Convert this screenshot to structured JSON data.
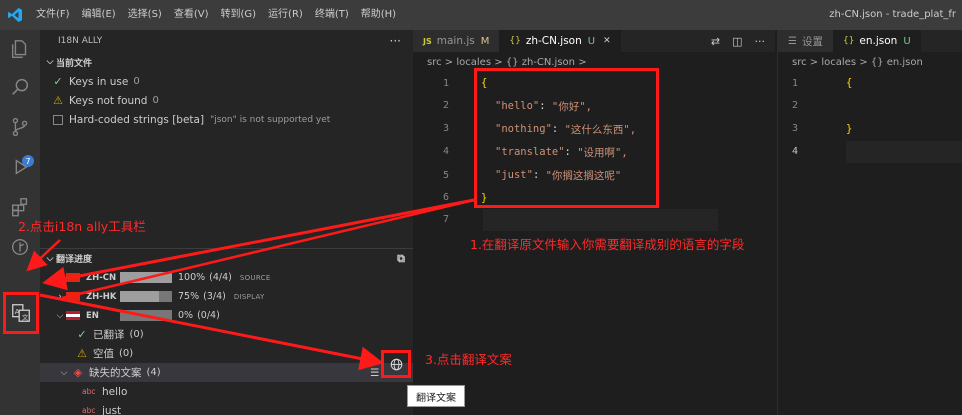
{
  "titlebar": {
    "menu": [
      "文件(F)",
      "编辑(E)",
      "选择(S)",
      "查看(V)",
      "转到(G)",
      "运行(R)",
      "终端(T)",
      "帮助(H)"
    ],
    "window_title": "zh-CN.json - trade_plat_fr"
  },
  "activity": {
    "git_badge": "7"
  },
  "sidebar": {
    "title": "I18N ALLY",
    "more": "···",
    "current_file": {
      "heading": "当前文件",
      "keys_in_use": {
        "label": "Keys in use",
        "count": "0"
      },
      "keys_not_found": {
        "label": "Keys not found",
        "count": "0"
      },
      "hardcoded": {
        "label": "Hard-coded strings [beta]",
        "desc": "\"json\" is not supported yet"
      }
    },
    "progress": {
      "heading": "翻译进度",
      "langs": [
        {
          "code": "ZH-CN",
          "pct": "100%",
          "ratio": "(4/4)",
          "tag": "SOURCE",
          "fill": 1.0
        },
        {
          "code": "ZH-HK",
          "pct": "75%",
          "ratio": "(3/4)",
          "tag": "DISPLAY",
          "fill": 0.75
        },
        {
          "code": "EN",
          "pct": "0%",
          "ratio": "(0/4)",
          "tag": "",
          "fill": 0.0
        }
      ],
      "translated": {
        "label": "已翻译",
        "count": "(0)"
      },
      "empty": {
        "label": "空值",
        "count": "(0)"
      },
      "missing": {
        "label": "缺失的文案",
        "count": "(4)"
      },
      "missing_items": [
        "hello",
        "just"
      ]
    }
  },
  "editor1": {
    "tabs": [
      {
        "icon": "JS",
        "label": "main.js",
        "state": "M"
      },
      {
        "icon": "{}",
        "label": "zh-CN.json",
        "state": "U",
        "close": "✕"
      }
    ],
    "breadcrumb": [
      "src",
      ">",
      "locales",
      ">",
      "{} zh-CN.json",
      ">"
    ],
    "lines": [
      "1",
      "2",
      "3",
      "4",
      "5",
      "6",
      "7"
    ],
    "code": {
      "open": "{",
      "close": "}",
      "entries": [
        {
          "key": "\"hello\"",
          "value": "\"你好\","
        },
        {
          "key": "\"nothing\"",
          "value": "\"这什么东西\","
        },
        {
          "key": "\"translate\"",
          "value": "\"设用啊\","
        },
        {
          "key": "\"just\"",
          "value": "\"你搁这搁这呢\""
        }
      ]
    }
  },
  "editor2": {
    "tabs": [
      {
        "label": "设置"
      },
      {
        "icon": "{}",
        "label": "en.json",
        "state": "U"
      }
    ],
    "breadcrumb": [
      "src",
      ">",
      "locales",
      ">",
      "{} en.json"
    ],
    "lines": [
      "1",
      "2",
      "3",
      "4"
    ],
    "open": "{",
    "close": "}"
  },
  "annotations": {
    "step1": "1.在翻译原文件输入你需要翻译成别的语言的字段",
    "step2": "2.点击i18n ally工具栏",
    "step3": "3.点击翻译文案",
    "tooltip": "翻译文案"
  },
  "colors": {
    "annotation_red": "#ff1a1a",
    "accent_blue": "#3a7bd5",
    "string_orange": "#ce9178"
  }
}
